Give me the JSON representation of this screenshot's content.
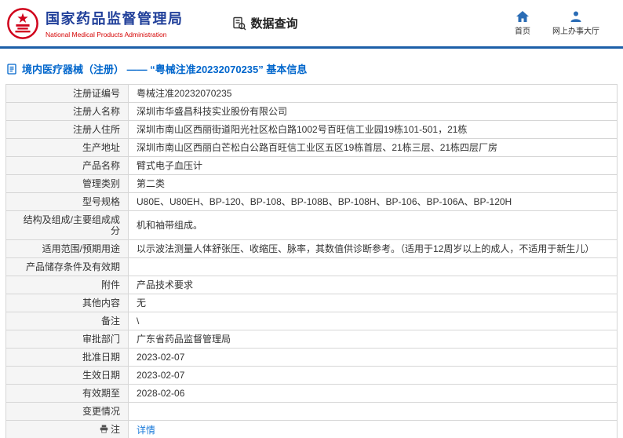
{
  "header": {
    "org_cn": "国家药品监督管理局",
    "org_en": "National Medical Products Administration",
    "query_label": "数据查询",
    "home_label": "首页",
    "hall_label": "网上办事大厅"
  },
  "breadcrumb": {
    "text": "境内医疗器械（注册） —— “粤械注准20232070235” 基本信息"
  },
  "colors": {
    "accent_blue": "#1c5fa8",
    "title_blue": "#21409a",
    "emblem_red": "#d0021b",
    "link_blue": "#1a7ad9"
  },
  "table": {
    "rows": [
      {
        "label": "注册证编号",
        "value": "粤械注准20232070235"
      },
      {
        "label": "注册人名称",
        "value": "深圳市华盛昌科技实业股份有限公司"
      },
      {
        "label": "注册人住所",
        "value": "深圳市南山区西丽街道阳光社区松白路1002号百旺信工业园19栋101-501，21栋"
      },
      {
        "label": "生产地址",
        "value": "深圳市南山区西丽白芒松白公路百旺信工业区五区19栋首层、21栋三层、21栋四层厂房"
      },
      {
        "label": "产品名称",
        "value": "臂式电子血压计"
      },
      {
        "label": "管理类别",
        "value": "第二类"
      },
      {
        "label": "型号规格",
        "value": "U80E、U80EH、BP-120、BP-108、BP-108B、BP-108H、BP-106、BP-106A、BP-120H"
      },
      {
        "label": "结构及组成/主要组成成分",
        "value": "机和袖带组成。"
      },
      {
        "label": "适用范围/预期用途",
        "value": "以示波法测量人体舒张压、收缩压、脉率，其数值供诊断参考。（适用于12周岁以上的成人，不适用于新生儿）"
      },
      {
        "label": "产品储存条件及有效期",
        "value": ""
      },
      {
        "label": "附件",
        "value": "产品技术要求"
      },
      {
        "label": "其他内容",
        "value": "无"
      },
      {
        "label": "备注",
        "value": "\\"
      },
      {
        "label": "审批部门",
        "value": "广东省药品监督管理局"
      },
      {
        "label": "批准日期",
        "value": "2023-02-07"
      },
      {
        "label": "生效日期",
        "value": "2023-02-07"
      },
      {
        "label": "有效期至",
        "value": "2028-02-06"
      },
      {
        "label": "变更情况",
        "value": ""
      },
      {
        "label": "注",
        "value": "详情",
        "link": true,
        "label_icon": "note-icon"
      }
    ]
  }
}
